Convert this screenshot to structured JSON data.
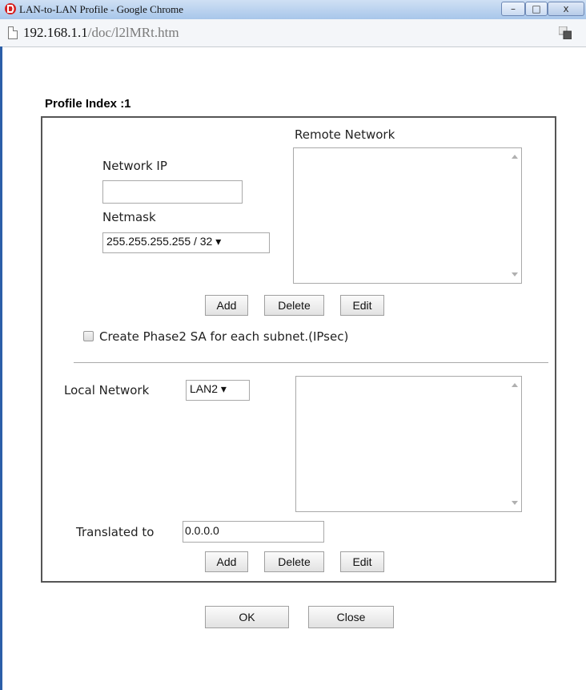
{
  "window": {
    "title": "LAN-to-LAN Profile - Google Chrome",
    "minimize_glyph": "–",
    "maximize_glyph": "□",
    "close_glyph": "x"
  },
  "address": {
    "host": "192.168.1.1",
    "path": "/doc/l2lMRt.htm"
  },
  "form": {
    "profile_index": "Profile Index :1",
    "remote_network_label": "Remote Network",
    "network_ip_label": "Network IP",
    "network_ip_value": "",
    "netmask_label": "Netmask",
    "netmask_value": "255.255.255.255 / 32 ▾",
    "remote_buttons": {
      "add": "Add",
      "delete": "Delete",
      "edit": "Edit"
    },
    "phase2_label": "Create Phase2 SA for each subnet.(IPsec)",
    "local_network_label": "Local Network",
    "local_network_value": "LAN2 ▾",
    "translated_label": "Translated to",
    "translated_value": "0.0.0.0",
    "local_buttons": {
      "add": "Add",
      "delete": "Delete",
      "edit": "Edit"
    }
  },
  "footer": {
    "ok": "OK",
    "close": "Close"
  },
  "icons": {
    "app": "draytek-logo-icon",
    "page": "page-icon",
    "translate": "translate-icon"
  }
}
